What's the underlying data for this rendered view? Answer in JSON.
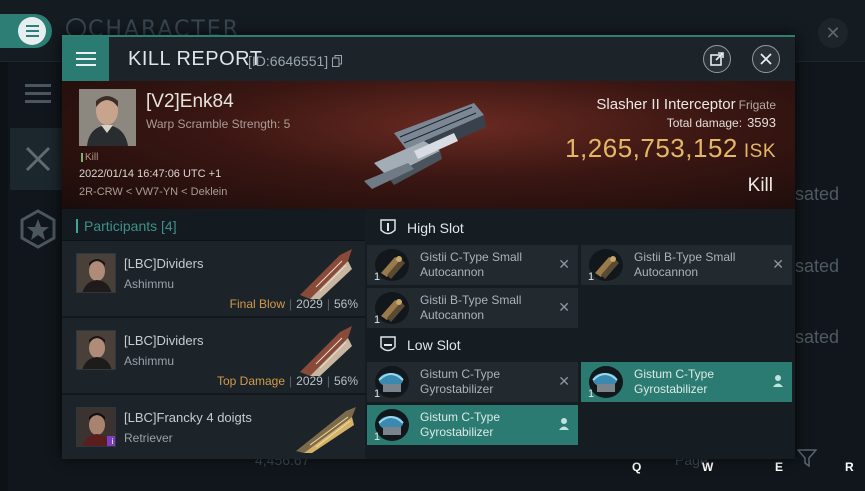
{
  "background": {
    "title": "CHARACTER",
    "list_items": [
      "sated",
      "sated",
      "sated"
    ],
    "bottom_value": "4,456.67",
    "bottom_page": "Page",
    "keys": [
      "Q",
      "W",
      "E",
      "R"
    ]
  },
  "kill_report": {
    "title": "KILL REPORT",
    "id_text": "[ID:6646551]",
    "victim": {
      "name": "[V2]Enk84",
      "warp_scramble": "Warp Scramble Strength: 5",
      "kill_tag": "Kill",
      "datetime": "2022/01/14 16:47:06 UTC +1",
      "location": "2R-CRW < VW7-YN < Deklein"
    },
    "ship": {
      "name": "Slasher II Interceptor",
      "class": "Frigate",
      "damage_label": "Total damage:",
      "damage_value": "3593",
      "value": "1,265,753,152",
      "currency": "ISK",
      "result": "Kill"
    },
    "participants": {
      "label": "Participants",
      "count": "[4]",
      "items": [
        {
          "name": "[LBC]Dividers",
          "ship": "Ashimmu",
          "role": "Final Blow",
          "damage": "2029",
          "percent": "56%"
        },
        {
          "name": "[LBC]Dividers",
          "ship": "Ashimmu",
          "role": "Top Damage",
          "damage": "2029",
          "percent": "56%"
        },
        {
          "name": "[LBC]Francky 4 doigts",
          "ship": "Retriever",
          "role": "",
          "damage": "",
          "percent": ""
        }
      ]
    },
    "high_slot": {
      "label": "High Slot",
      "modules": [
        {
          "qty": "1",
          "name": "Gistii C-Type Small Autocannon"
        },
        {
          "qty": "1",
          "name": "Gistii B-Type Small Autocannon"
        },
        {
          "qty": "1",
          "name": "Gistii B-Type Small Autocannon"
        }
      ]
    },
    "low_slot": {
      "label": "Low Slot",
      "modules": [
        {
          "qty": "1",
          "name": "Gistum C-Type Gyrostabilizer"
        },
        {
          "qty": "1",
          "name": "Gistum C-Type Gyrostabilizer"
        },
        {
          "qty": "1",
          "name": "Gistum C-Type Gyrostabilizer"
        }
      ]
    },
    "colors": {
      "accent": "#2c7b72",
      "isk": "#e4b767",
      "role": "#d19a4c"
    }
  }
}
